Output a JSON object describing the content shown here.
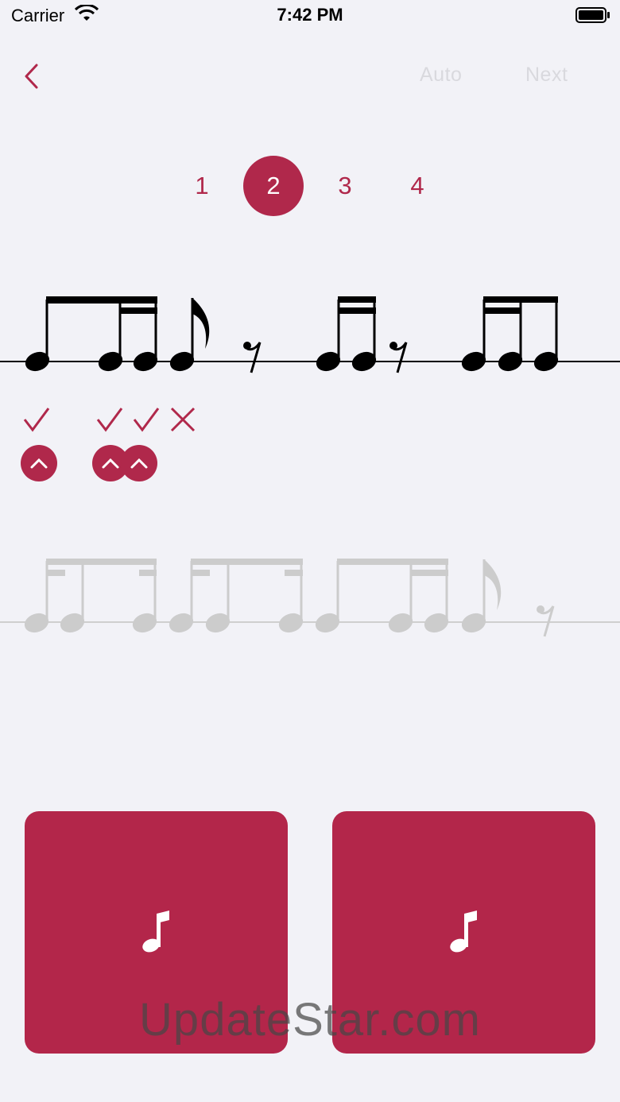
{
  "status_bar": {
    "carrier": "Carrier",
    "time": "7:42 PM"
  },
  "nav": {
    "auto_label": "Auto",
    "next_label": "Next"
  },
  "pager": {
    "pages": [
      "1",
      "2",
      "3",
      "4"
    ],
    "active_index": 1
  },
  "feedback": {
    "results": [
      "correct",
      "correct",
      "correct",
      "wrong"
    ],
    "hits": 3
  },
  "watermark": "UpdateStar.com",
  "colors": {
    "accent": "#b0284b",
    "button": "#b3264a",
    "pending": "#cccccc",
    "disabled_text": "#d9d9de"
  },
  "icons": {
    "back": "chevron-left-icon",
    "play": "music-note-icon",
    "hit": "chevron-up-icon"
  }
}
